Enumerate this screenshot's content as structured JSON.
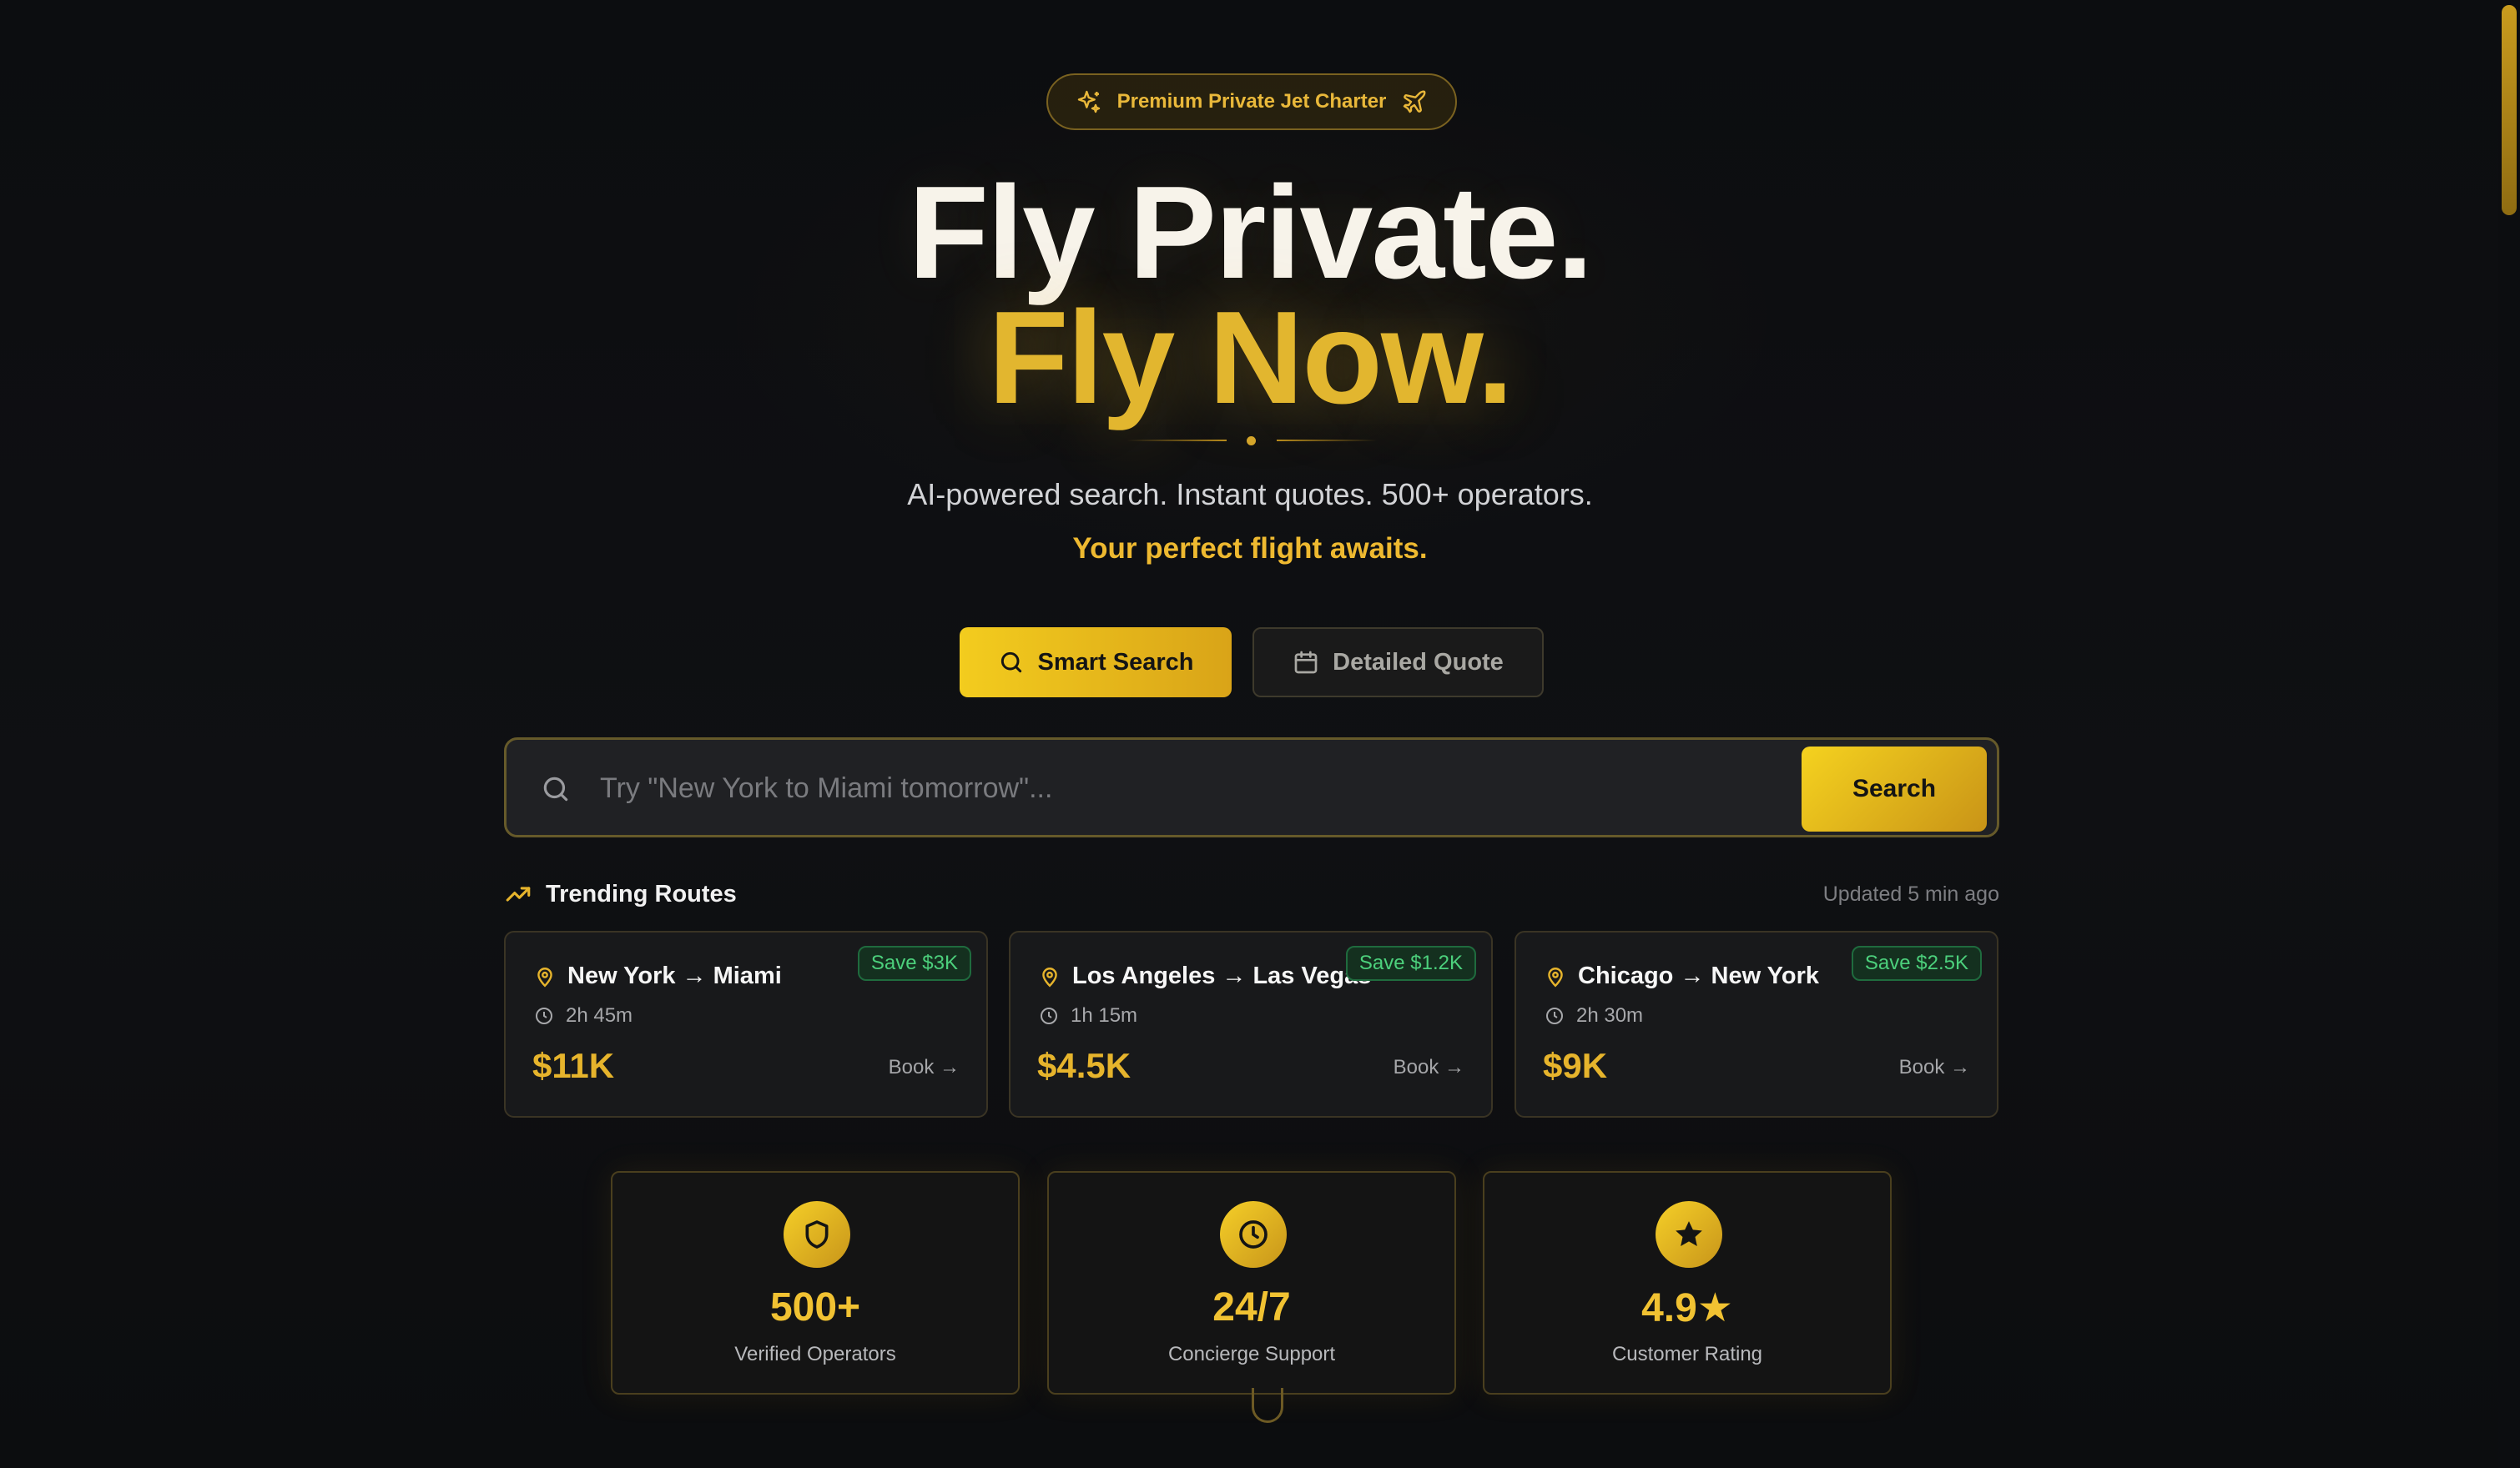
{
  "badge": {
    "label": "Premium Private Jet Charter",
    "left_icon": "sparkles-icon",
    "right_icon": "plane-icon"
  },
  "hero": {
    "line1": "Fly Private.",
    "line2": "Fly Now.",
    "subtitle": "AI-powered search. Instant quotes. 500+ operators.",
    "tagline": "Your perfect flight awaits."
  },
  "mode_buttons": {
    "smart_search": "Smart Search",
    "detailed_quote": "Detailed Quote"
  },
  "search": {
    "placeholder": "Try \"New York to Miami tomorrow\"...",
    "value": "",
    "button": "Search"
  },
  "trending": {
    "title": "Trending Routes",
    "updated": "Updated 5 min ago",
    "routes": [
      {
        "route": "New York → Miami",
        "duration": "2h 45m",
        "price": "$11K",
        "save": "Save $3K",
        "book": "Book →"
      },
      {
        "route": "Los Angeles → Las Vegas",
        "duration": "1h 15m",
        "price": "$4.5K",
        "save": "Save $1.2K",
        "book": "Book →"
      },
      {
        "route": "Chicago → New York",
        "duration": "2h 30m",
        "price": "$9K",
        "save": "Save $2.5K",
        "book": "Book →"
      }
    ]
  },
  "stats": [
    {
      "value": "500+",
      "label": "Verified Operators",
      "icon": "shield-icon"
    },
    {
      "value": "24/7",
      "label": "Concierge Support",
      "icon": "clock-icon"
    },
    {
      "value": "4.9★",
      "label": "Customer Rating",
      "icon": "star-icon"
    }
  ],
  "colors": {
    "accent_gold": "#e6b42c",
    "save_green": "#4cd07c",
    "background": "#0c0d10"
  }
}
